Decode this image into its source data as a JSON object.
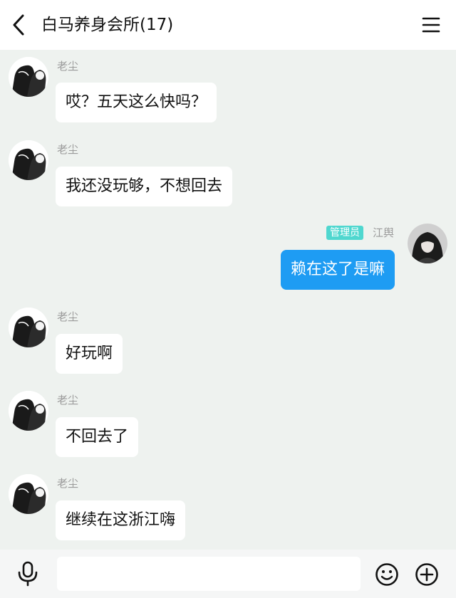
{
  "header": {
    "title": "白马养身会所(17)",
    "back_icon": "chevron-left-icon",
    "menu_icon": "hamburger-menu-icon"
  },
  "messages": [
    {
      "sender": "老尘",
      "text": "哎？五天这么快吗？",
      "side": "left"
    },
    {
      "sender": "老尘",
      "text": "我还没玩够，不想回去",
      "side": "left"
    },
    {
      "sender": "江舆",
      "badge": "管理员",
      "text": "赖在这了是嘛",
      "side": "right"
    },
    {
      "sender": "老尘",
      "text": "好玩啊",
      "side": "left"
    },
    {
      "sender": "老尘",
      "text": "不回去了",
      "side": "left"
    },
    {
      "sender": "老尘",
      "text": "继续在这浙江嗨",
      "side": "left"
    }
  ],
  "footer": {
    "input_value": "",
    "mic_icon": "microphone-icon",
    "emoji_icon": "emoji-smile-icon",
    "plus_icon": "plus-circle-icon"
  },
  "colors": {
    "chat_background": "#eef2ef",
    "my_bubble": "#1e9cf3",
    "other_bubble": "#ffffff",
    "admin_badge": "#4fd7cf",
    "sender_name": "#9a9a9a"
  }
}
